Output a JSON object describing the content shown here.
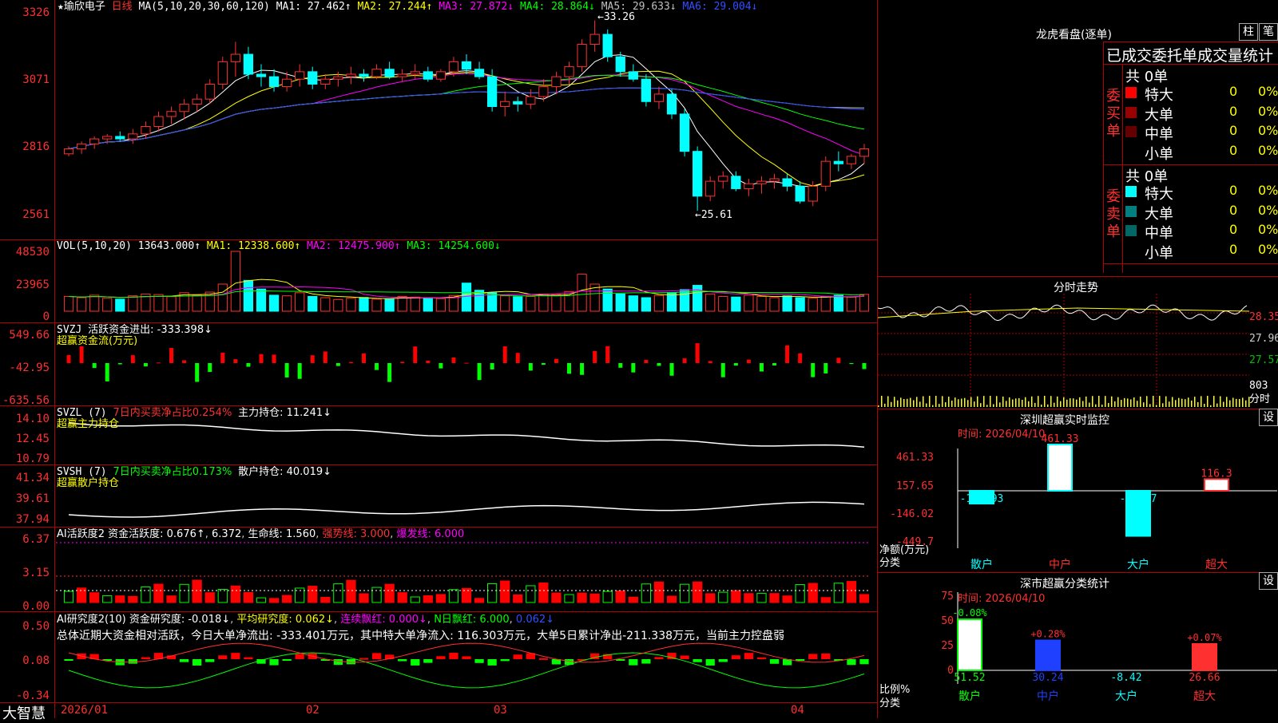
{
  "header": {
    "star": "★",
    "stock": "瑜欣电子",
    "period": "日线",
    "ma_label": "MA(5,10,20,30,60,120)",
    "ma_values": [
      {
        "label": "MA1:",
        "value": "27.462↑",
        "color": "#ffffff"
      },
      {
        "label": "MA2:",
        "value": "27.244↑",
        "color": "#ffff00"
      },
      {
        "label": "MA3:",
        "value": "27.872↓",
        "color": "#ff00ff"
      },
      {
        "label": "MA4:",
        "value": "28.864↓",
        "color": "#00ff00"
      },
      {
        "label": "MA5:",
        "value": "29.633↓",
        "color": "#c0c0c0"
      },
      {
        "label": "MA6:",
        "value": "29.004↓",
        "color": "#3050ff"
      }
    ],
    "high_mark": "33.26",
    "low_mark": "25.61"
  },
  "price_axis": [
    "3326",
    "3071",
    "2816",
    "2561"
  ],
  "vol": {
    "label": "VOL(5,10,20)",
    "value": "13643.000↑",
    "items": [
      {
        "label": "MA1:",
        "value": "12338.600↑",
        "color": "#ffff00"
      },
      {
        "label": "MA2:",
        "value": "12475.900↑",
        "color": "#ff00ff"
      },
      {
        "label": "MA3:",
        "value": "14254.600↓",
        "color": "#00ff00"
      }
    ],
    "axis": [
      "48530",
      "23965",
      "0"
    ]
  },
  "svzj": {
    "label": "SVZJ",
    "text": "活跃资金进出: -333.398↓",
    "sub": "超赢资金流(万元)",
    "axis": [
      "549.66",
      "-42.95",
      "-635.56"
    ]
  },
  "svzl": {
    "label": "SVZL (7)",
    "text1": "7日内买卖净占比0.254%",
    "text2": "主力持仓: 11.241↓",
    "sub": "超赢主力持仓",
    "axis": [
      "14.10",
      "12.45",
      "10.79"
    ]
  },
  "svsh": {
    "label": "SVSH (7)",
    "text1": "7日内买卖净占比0.173%",
    "text2": "散户持仓: 40.019↓",
    "sub": "超赢散户持仓",
    "axis": [
      "41.34",
      "39.61",
      "37.94"
    ]
  },
  "ai1": {
    "label": "AI活跃度2",
    "t1": "资金活跃度: 0.676↑",
    "t2": "6.372",
    "t3": "生命线: 1.560",
    "t4": "强势线: 3.000",
    "t5": "爆发线: 6.000",
    "axis": [
      "6.37",
      "3.15",
      "0.00"
    ]
  },
  "ai2": {
    "label": "AI研究度2(10)",
    "t1": "资金研究度: -0.018↓",
    "t2": "平均研究度: 0.062↓",
    "t3": "连续飘红: 0.000↓",
    "t4": "N日飘红: 6.000",
    "t5": "0.062↓",
    "summary": "总体近期大资金相对活跃，今日大单净流出: -333.401万元，其中特大单净流入: 116.303万元，大单5日累计净出-211.338万元，当前主力控盘弱",
    "axis": [
      "0.50",
      "0.08",
      "-0.34"
    ]
  },
  "date_axis": [
    "2026/01",
    "02",
    "03",
    "04"
  ],
  "brand": "大智慧",
  "right": {
    "lhb_title": "龙虎看盘(逐单)",
    "btn1": "柱",
    "btn2": "笔",
    "tabs_title": "已成交委托单成交量统计",
    "buy_side": "委买单",
    "sell_side": "委卖单",
    "buy_total": "共 0单",
    "sell_total": "共 0单",
    "buy_rows": [
      {
        "name": "特大",
        "count": "0",
        "pct": "0%",
        "color": "#ff0000"
      },
      {
        "name": "大单",
        "count": "0",
        "pct": "0%",
        "color": "#990000"
      },
      {
        "name": "中单",
        "count": "0",
        "pct": "0%",
        "color": "#660000"
      },
      {
        "name": "小单",
        "count": "0",
        "pct": "0%",
        "color": "#000000"
      }
    ],
    "sell_rows": [
      {
        "name": "特大",
        "count": "0",
        "pct": "0%",
        "color": "#00ffff"
      },
      {
        "name": "大单",
        "count": "0",
        "pct": "0%",
        "color": "#008080"
      },
      {
        "name": "中单",
        "count": "0",
        "pct": "0%",
        "color": "#006666"
      },
      {
        "name": "小单",
        "count": "0",
        "pct": "0%",
        "color": "#000000"
      }
    ],
    "fs_title": "分时走势",
    "fs_axis": [
      "28.35",
      "27.96",
      "27.57",
      "803",
      "分时"
    ],
    "monitor_title": "深圳超赢实时监控",
    "monitor_btn": "设",
    "monitor_time": "时间: 2026/04/10",
    "monitor_axis": [
      "461.33",
      "157.65",
      "-146.02",
      "-449.7"
    ],
    "monitor_unit": "净额(万元)",
    "monitor_cat": "分类",
    "monitor_bars": [
      {
        "name": "散户",
        "value": -127.93,
        "label": "-127.93"
      },
      {
        "name": "中户",
        "value": 461.33,
        "label": "461.33"
      },
      {
        "name": "大户",
        "value": -449.7,
        "label": "-449.7"
      },
      {
        "name": "超大",
        "value": 116.3,
        "label": "116.3"
      }
    ],
    "class_title": "深市超赢分类统计",
    "class_btn": "设",
    "class_time": "时间: 2026/04/10",
    "class_axis": [
      "75",
      "50",
      "25",
      "0"
    ],
    "class_unit": "比例%",
    "class_cat": "分类",
    "class_bars": [
      {
        "name": "散户",
        "value": 51.52,
        "label": "51.52",
        "delta": "-0.08%"
      },
      {
        "name": "中户",
        "value": 30.24,
        "label": "30.24",
        "delta": "+0.28%"
      },
      {
        "name": "大户",
        "value": -8.42,
        "label": "-8.42",
        "delta": ""
      },
      {
        "name": "超大",
        "value": 26.66,
        "label": "26.66",
        "delta": "+0.07%"
      }
    ]
  },
  "chart_data": {
    "type": "candlestick",
    "candles": [
      [
        27.9,
        28.2,
        27.8,
        28.1
      ],
      [
        28.1,
        28.4,
        27.9,
        28.3
      ],
      [
        28.3,
        28.6,
        28.1,
        28.5
      ],
      [
        28.5,
        28.7,
        28.3,
        28.6
      ],
      [
        28.6,
        28.8,
        28.4,
        28.5
      ],
      [
        28.5,
        28.9,
        28.3,
        28.7
      ],
      [
        28.7,
        29.2,
        28.5,
        29.0
      ],
      [
        29.0,
        29.6,
        28.8,
        29.4
      ],
      [
        29.4,
        29.8,
        29.1,
        29.6
      ],
      [
        29.6,
        30.1,
        29.3,
        29.9
      ],
      [
        29.9,
        30.3,
        29.6,
        30.1
      ],
      [
        30.1,
        30.9,
        29.9,
        30.7
      ],
      [
        30.7,
        31.8,
        30.5,
        31.6
      ],
      [
        31.6,
        32.4,
        31.0,
        31.9
      ],
      [
        31.9,
        32.2,
        30.9,
        31.1
      ],
      [
        31.1,
        31.5,
        30.6,
        31.0
      ],
      [
        31.0,
        31.3,
        30.4,
        30.6
      ],
      [
        30.6,
        31.2,
        30.4,
        30.9
      ],
      [
        30.9,
        31.5,
        30.6,
        31.2
      ],
      [
        31.2,
        31.4,
        30.5,
        30.7
      ],
      [
        30.7,
        31.1,
        30.5,
        30.9
      ],
      [
        30.9,
        31.2,
        30.6,
        31.0
      ],
      [
        31.0,
        31.4,
        30.7,
        31.1
      ],
      [
        31.1,
        31.3,
        30.8,
        31.0
      ],
      [
        31.0,
        31.5,
        30.9,
        31.3
      ],
      [
        31.3,
        31.6,
        30.9,
        31.0
      ],
      [
        31.0,
        31.3,
        30.8,
        31.1
      ],
      [
        31.1,
        31.5,
        30.9,
        31.2
      ],
      [
        31.2,
        31.4,
        30.8,
        30.9
      ],
      [
        30.9,
        31.3,
        30.8,
        31.2
      ],
      [
        31.2,
        31.8,
        31.0,
        31.6
      ],
      [
        31.6,
        31.9,
        31.1,
        31.3
      ],
      [
        31.3,
        31.6,
        30.9,
        31.0
      ],
      [
        31.0,
        31.3,
        29.6,
        29.8
      ],
      [
        29.8,
        30.4,
        29.4,
        30.0
      ],
      [
        30.0,
        30.2,
        29.6,
        29.9
      ],
      [
        29.9,
        30.5,
        29.7,
        30.2
      ],
      [
        30.2,
        30.9,
        30.0,
        30.6
      ],
      [
        30.6,
        31.2,
        30.3,
        31.0
      ],
      [
        31.0,
        31.6,
        30.7,
        31.4
      ],
      [
        31.4,
        32.5,
        31.2,
        32.3
      ],
      [
        32.3,
        33.26,
        32.0,
        32.7
      ],
      [
        32.7,
        32.9,
        31.6,
        31.8
      ],
      [
        31.8,
        32.0,
        31.0,
        31.2
      ],
      [
        31.2,
        31.5,
        30.8,
        30.9
      ],
      [
        30.9,
        31.1,
        29.8,
        30.0
      ],
      [
        30.0,
        30.6,
        29.7,
        30.3
      ],
      [
        30.3,
        30.5,
        29.3,
        29.5
      ],
      [
        29.5,
        29.7,
        27.8,
        28.0
      ],
      [
        28.0,
        28.2,
        25.61,
        26.2
      ],
      [
        26.2,
        27.0,
        26.0,
        26.8
      ],
      [
        26.8,
        27.2,
        26.5,
        27.0
      ],
      [
        27.0,
        27.2,
        26.4,
        26.5
      ],
      [
        26.5,
        26.9,
        26.2,
        26.7
      ],
      [
        26.7,
        27.0,
        26.3,
        26.8
      ],
      [
        26.8,
        27.1,
        26.5,
        26.9
      ],
      [
        26.9,
        27.1,
        26.4,
        26.6
      ],
      [
        26.6,
        26.8,
        25.9,
        26.0
      ],
      [
        26.0,
        26.8,
        25.8,
        26.6
      ],
      [
        26.6,
        27.8,
        26.4,
        27.6
      ],
      [
        27.6,
        28.0,
        27.2,
        27.5
      ],
      [
        27.5,
        27.9,
        27.3,
        27.8
      ],
      [
        27.8,
        28.3,
        27.5,
        28.1
      ]
    ],
    "volume": [
      12000,
      11000,
      13000,
      10500,
      9800,
      12500,
      14000,
      13500,
      11800,
      15000,
      13000,
      15500,
      22000,
      48530,
      25000,
      18000,
      13000,
      12500,
      15000,
      12000,
      11000,
      9500,
      10500,
      11200,
      9800,
      10000,
      12000,
      11500,
      10800,
      10200,
      12800,
      22800,
      17000,
      15000,
      12500,
      11800,
      12000,
      14000,
      13500,
      16000,
      30000,
      22000,
      18000,
      14000,
      12500,
      11000,
      12800,
      15000,
      17500,
      21000,
      14000,
      12000,
      11500,
      13000,
      12000,
      11000,
      12500,
      11000,
      10500,
      12000,
      13000,
      11500,
      13643
    ],
    "ylim": [
      25.2,
      33.6
    ],
    "x_labels": [
      "2026/01",
      "02",
      "03",
      "04"
    ]
  }
}
